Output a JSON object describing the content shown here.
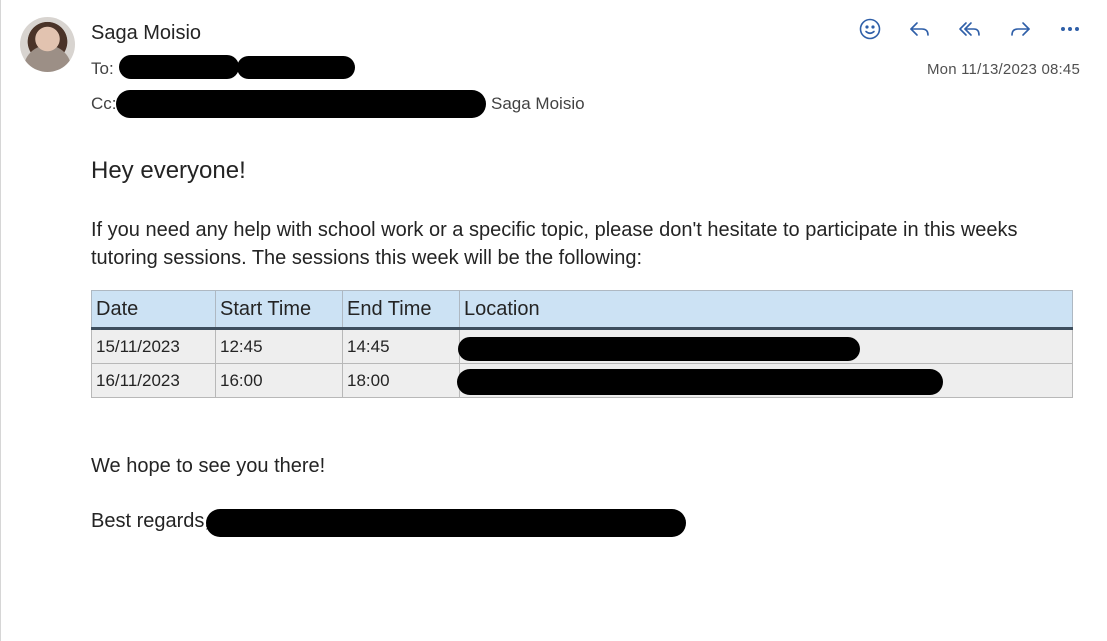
{
  "header": {
    "sender_name": "Saga Moisio",
    "to_label": "To:",
    "cc_label": "Cc:",
    "cc_visible_name": "Saga Moisio",
    "date": "Mon 11/13/2023 08:45",
    "actions": [
      {
        "name": "emoji-icon"
      },
      {
        "name": "reply-icon"
      },
      {
        "name": "reply-all-icon"
      },
      {
        "name": "forward-icon"
      },
      {
        "name": "more-icon"
      }
    ]
  },
  "body": {
    "greeting": "Hey everyone!",
    "intro": "If you need any help with school work or a specific topic, please don't hesitate to participate in this weeks tutoring sessions. The sessions this week will be the following:",
    "table": {
      "headers": [
        "Date",
        "Start Time",
        "End Time",
        "Location"
      ],
      "rows": [
        [
          "15/11/2023",
          "12:45",
          "14:45",
          ""
        ],
        [
          "16/11/2023",
          "16:00",
          "18:00",
          ""
        ]
      ]
    },
    "closing": "We hope to see you there!",
    "signoff": "Best regards,"
  }
}
